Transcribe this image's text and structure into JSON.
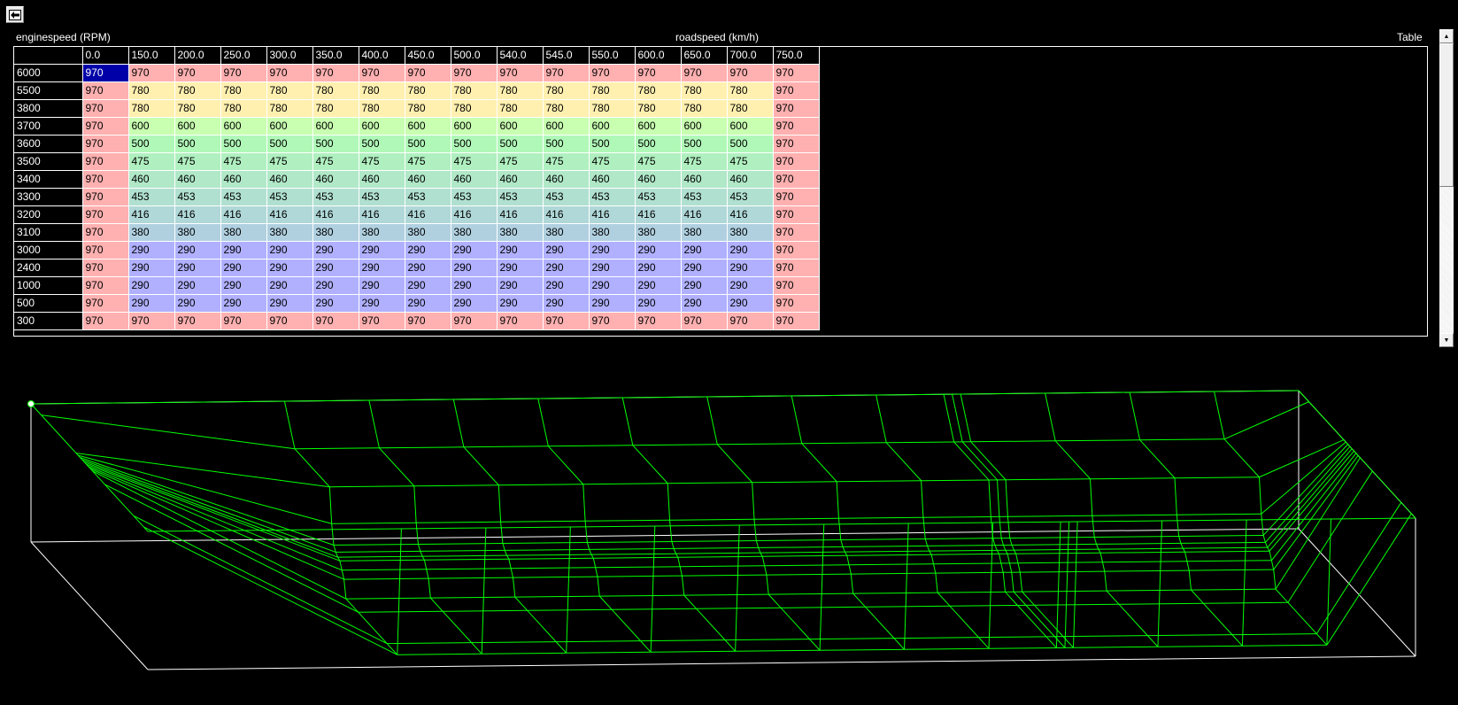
{
  "toolbar": {
    "back_icon": "arrow-left-icon"
  },
  "labels": {
    "y_axis": "enginespeed (RPM)",
    "x_axis": "roadspeed (km/h)",
    "view_mode": "Table"
  },
  "table": {
    "columns": [
      "0.0",
      "150.0",
      "200.0",
      "250.0",
      "300.0",
      "350.0",
      "400.0",
      "450.0",
      "500.0",
      "540.0",
      "545.0",
      "550.0",
      "600.0",
      "650.0",
      "700.0",
      "750.0"
    ],
    "rows": [
      {
        "rpm": "6000",
        "values": [
          970,
          970,
          970,
          970,
          970,
          970,
          970,
          970,
          970,
          970,
          970,
          970,
          970,
          970,
          970,
          970
        ]
      },
      {
        "rpm": "5500",
        "values": [
          970,
          780,
          780,
          780,
          780,
          780,
          780,
          780,
          780,
          780,
          780,
          780,
          780,
          780,
          780,
          970
        ]
      },
      {
        "rpm": "3800",
        "values": [
          970,
          780,
          780,
          780,
          780,
          780,
          780,
          780,
          780,
          780,
          780,
          780,
          780,
          780,
          780,
          970
        ]
      },
      {
        "rpm": "3700",
        "values": [
          970,
          600,
          600,
          600,
          600,
          600,
          600,
          600,
          600,
          600,
          600,
          600,
          600,
          600,
          600,
          970
        ]
      },
      {
        "rpm": "3600",
        "values": [
          970,
          500,
          500,
          500,
          500,
          500,
          500,
          500,
          500,
          500,
          500,
          500,
          500,
          500,
          500,
          970
        ]
      },
      {
        "rpm": "3500",
        "values": [
          970,
          475,
          475,
          475,
          475,
          475,
          475,
          475,
          475,
          475,
          475,
          475,
          475,
          475,
          475,
          970
        ]
      },
      {
        "rpm": "3400",
        "values": [
          970,
          460,
          460,
          460,
          460,
          460,
          460,
          460,
          460,
          460,
          460,
          460,
          460,
          460,
          460,
          970
        ]
      },
      {
        "rpm": "3300",
        "values": [
          970,
          453,
          453,
          453,
          453,
          453,
          453,
          453,
          453,
          453,
          453,
          453,
          453,
          453,
          453,
          970
        ]
      },
      {
        "rpm": "3200",
        "values": [
          970,
          416,
          416,
          416,
          416,
          416,
          416,
          416,
          416,
          416,
          416,
          416,
          416,
          416,
          416,
          970
        ]
      },
      {
        "rpm": "3100",
        "values": [
          970,
          380,
          380,
          380,
          380,
          380,
          380,
          380,
          380,
          380,
          380,
          380,
          380,
          380,
          380,
          970
        ]
      },
      {
        "rpm": "3000",
        "values": [
          970,
          290,
          290,
          290,
          290,
          290,
          290,
          290,
          290,
          290,
          290,
          290,
          290,
          290,
          290,
          970
        ]
      },
      {
        "rpm": "2400",
        "values": [
          970,
          290,
          290,
          290,
          290,
          290,
          290,
          290,
          290,
          290,
          290,
          290,
          290,
          290,
          290,
          970
        ]
      },
      {
        "rpm": "1000",
        "values": [
          970,
          290,
          290,
          290,
          290,
          290,
          290,
          290,
          290,
          290,
          290,
          290,
          290,
          290,
          290,
          970
        ]
      },
      {
        "rpm": "500",
        "values": [
          970,
          290,
          290,
          290,
          290,
          290,
          290,
          290,
          290,
          290,
          290,
          290,
          290,
          290,
          290,
          970
        ]
      },
      {
        "rpm": "300",
        "values": [
          970,
          970,
          970,
          970,
          970,
          970,
          970,
          970,
          970,
          970,
          970,
          970,
          970,
          970,
          970,
          970
        ]
      }
    ],
    "selected": {
      "row": 0,
      "col": 0
    }
  },
  "value_colors": {
    "970": "#ffb0b0",
    "780": "#fff0b0",
    "600": "#c8ffb0",
    "500": "#b0f8b8",
    "475": "#b0f0c0",
    "460": "#b0e8c8",
    "453": "#b0e0d0",
    "416": "#b0d8d8",
    "380": "#b0d0e0",
    "290": "#b0b0ff"
  },
  "plot_colors": {
    "mesh": "#00ff00",
    "box": "#ffffff",
    "marker": "#ffffff"
  },
  "scrollbar": {
    "position": 0.0
  }
}
